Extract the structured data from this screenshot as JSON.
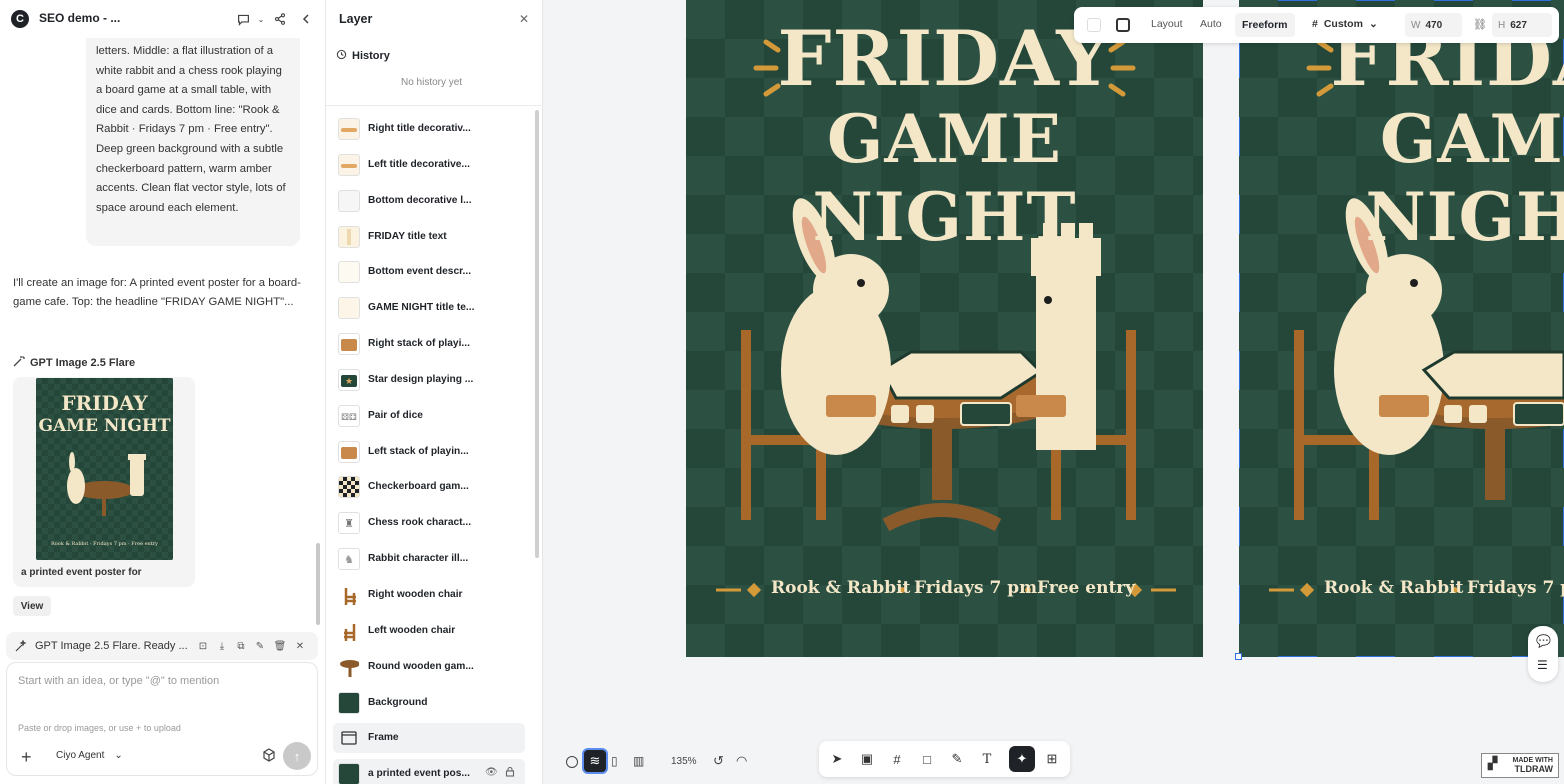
{
  "app": {
    "title": "SEO demo - ...",
    "logo": "C"
  },
  "chat": {
    "user_prompt": "letters. Middle: a flat illustration of a white rabbit and a chess rook playing a board game at a small table, with dice and cards. Bottom line: \"Rook & Rabbit · Fridays 7 pm · Free entry\". Deep green background with a subtle checkerboard pattern, warm amber accents. Clean flat vector style, lots of space around each element.",
    "ai_reply": "I'll create an image for: A printed event poster for a board-game cafe. Top: the headline \"FRIDAY GAME NIGHT\"...",
    "model_label": "GPT Image 2.5 Flare",
    "image_caption": "a printed event poster for",
    "view_label": "View",
    "task_status": "GPT Image 2.5 Flare. Ready ...",
    "composer_placeholder": "Start with an idea, or type \"@\" to mention",
    "composer_hint": "Paste or drop images, or use + to upload",
    "agent_label": "Ciyo Agent"
  },
  "layers": {
    "title": "Layer",
    "history_label": "History",
    "no_history": "No history yet",
    "items": [
      {
        "label": "Right title decorativ..."
      },
      {
        "label": "Left title decorative..."
      },
      {
        "label": "Bottom decorative l..."
      },
      {
        "label": "FRIDAY title text"
      },
      {
        "label": "Bottom event descr..."
      },
      {
        "label": "GAME NIGHT title te..."
      },
      {
        "label": "Right stack of playi..."
      },
      {
        "label": "Star design playing ..."
      },
      {
        "label": "Pair of dice"
      },
      {
        "label": "Left stack of playin..."
      },
      {
        "label": "Checkerboard gam..."
      },
      {
        "label": "Chess rook charact..."
      },
      {
        "label": "Rabbit character ill..."
      },
      {
        "label": "Right wooden chair"
      },
      {
        "label": "Left wooden chair"
      },
      {
        "label": "Round wooden gam..."
      },
      {
        "label": "Background"
      },
      {
        "label": "Frame"
      },
      {
        "label": "a printed event pos..."
      }
    ]
  },
  "poster": {
    "line1": "FRIDAY",
    "line2": "GAME NIGHT",
    "footer_1": "Rook & Rabbit",
    "footer_2": "Fridays 7 pm",
    "footer_3": "Free entry",
    "thumb_footer": "Rook & Rabbit · Fridays 7 pm · Free entry"
  },
  "toolbar": {
    "layout_label": "Layout",
    "auto_label": "Auto",
    "freeform_label": "Freeform",
    "custom_label": "Custom",
    "w_label": "W",
    "w_value": "470",
    "h_label": "H",
    "h_value": "627"
  },
  "bottom": {
    "zoom": "135%",
    "tldraw_line1": "MADE WITH",
    "tldraw_line2": "TLDRAW"
  },
  "colors": {
    "poster_green": "#25473a",
    "poster_cream": "#f3e7c8",
    "accent_amber": "#d49a3a",
    "selection_blue": "#2f6fde"
  }
}
